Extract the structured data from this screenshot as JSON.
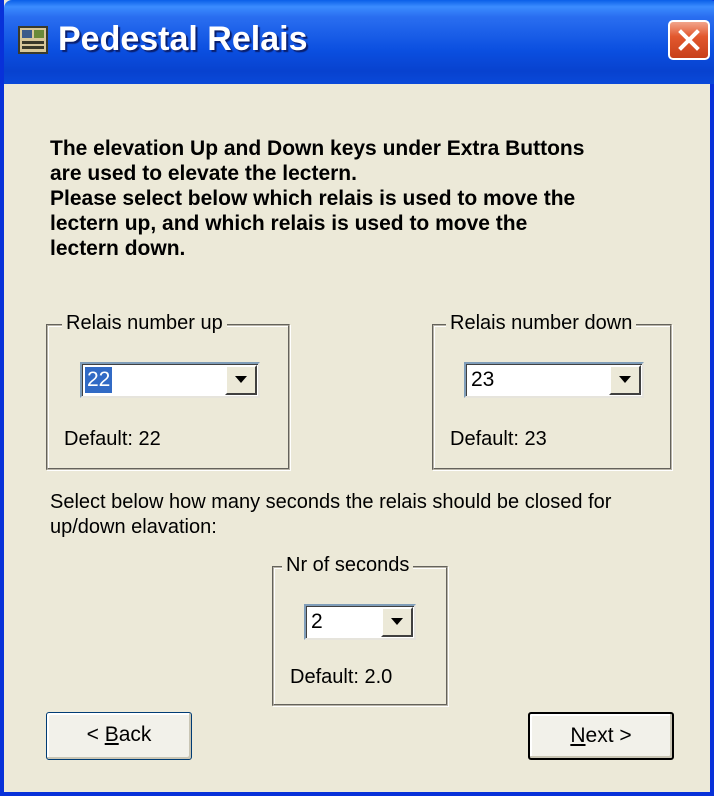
{
  "window": {
    "title": "Pedestal Relais",
    "icon": "app-icon",
    "close_icon": "close-icon"
  },
  "intro": {
    "lines": [
      "The elevation Up and Down keys under Extra Buttons",
      "are used to elevate the lectern.",
      "Please select below which relais is used to move the",
      "lectern up, and which relais is used to move the",
      "lectern down."
    ]
  },
  "relais_up": {
    "label": "Relais number up",
    "value": "22",
    "default_text": "Default: 22"
  },
  "relais_down": {
    "label": "Relais number down",
    "value": "23",
    "default_text": "Default: 23"
  },
  "seconds_prompt": {
    "line1": "Select below how many seconds the relais should be closed for",
    "line2": "up/down elavation:"
  },
  "seconds": {
    "label": "Nr of seconds",
    "value": "2",
    "default_text": "Default: 2.0"
  },
  "buttons": {
    "back_prefix": "< ",
    "back_mnemonic": "B",
    "back_rest": "ack",
    "next_mnemonic": "N",
    "next_rest": "ext >"
  },
  "colors": {
    "titlebar": "#0842CF",
    "face": "#ECE9D8",
    "selection": "#316AC5",
    "close": "#E2582E"
  }
}
